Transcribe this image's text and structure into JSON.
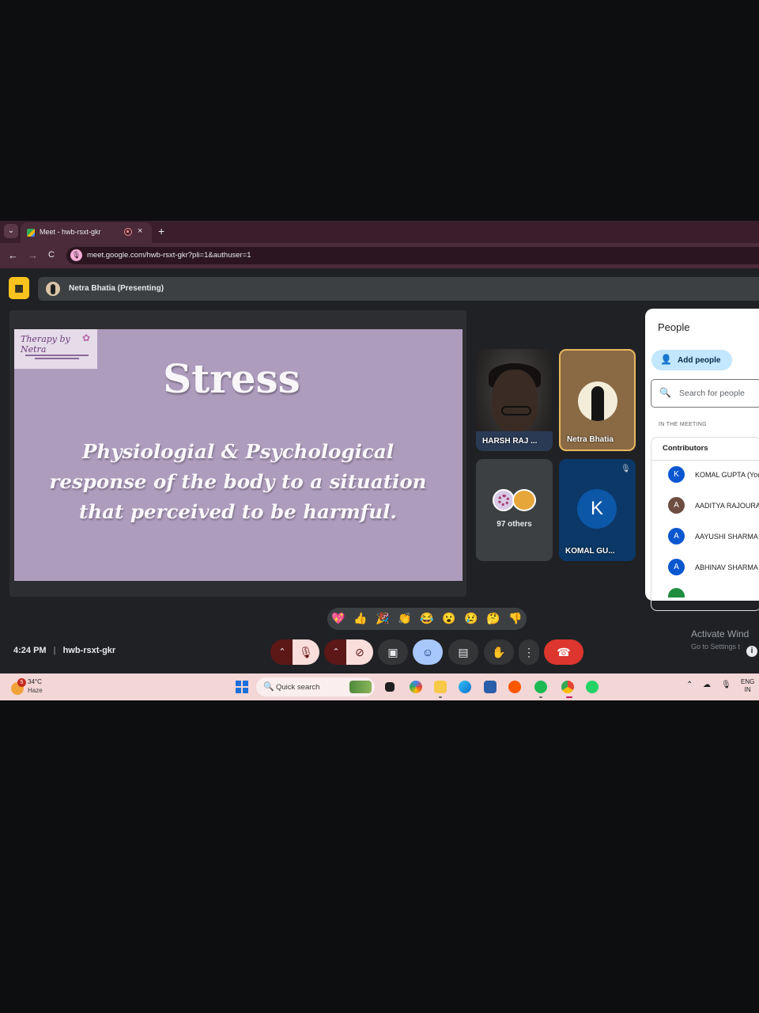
{
  "browser": {
    "tab_title": "Meet - hwb-rsxt-gkr",
    "tab_close": "×",
    "new_tab": "+",
    "back": "←",
    "forward": "→",
    "reload": "C",
    "url": "meet.google.com/hwb-rsxt-gkr?pli=1&authuser=1"
  },
  "presenting": {
    "presenter_label": "Netra Bhatia (Presenting)"
  },
  "slide": {
    "logo_text": "Therapy by Netra",
    "title": "Stress",
    "line1": "Physiologial & Psychological",
    "line2": "response of the body to a situation",
    "line3": "that perceived to be harmful."
  },
  "tiles": {
    "t1_name": "HARSH RAJ ...",
    "t2_name": "Netra Bhatia",
    "t3_count": "97 others",
    "t4_initial": "K",
    "t4_name": "KOMAL GU..."
  },
  "people_panel": {
    "title": "People",
    "add_label": "Add people",
    "search_placeholder": "Search for people",
    "section": "IN THE MEETING",
    "group": "Contributors",
    "participants": [
      {
        "initial": "K",
        "name": "KOMAL GUPTA (You",
        "color": "#0b57d0"
      },
      {
        "initial": "A",
        "name": "AADITYA RAJOURA",
        "color": "#6d4c41"
      },
      {
        "initial": "A",
        "name": "AAYUSHI SHARMA",
        "color": "#0b57d0"
      },
      {
        "initial": "A",
        "name": "ABHINAV SHARMA",
        "color": "#0b57d0"
      }
    ]
  },
  "reactions": [
    "💖",
    "👍",
    "🎉",
    "👏",
    "😂",
    "😮",
    "😢",
    "🤔",
    "👎"
  ],
  "bottom_bar": {
    "time": "4:24 PM",
    "separator": "|",
    "meeting_code": "hwb-rsxt-gkr",
    "end_call_color": "#dc362e"
  },
  "watermark": {
    "line1": "Activate Wind",
    "line2": "Go to Settings t"
  },
  "taskbar": {
    "weather_badge": "5",
    "temp": "34°C",
    "condition": "Haze",
    "search_placeholder": "Quick search",
    "lang1": "ENG",
    "lang2": "IN"
  }
}
